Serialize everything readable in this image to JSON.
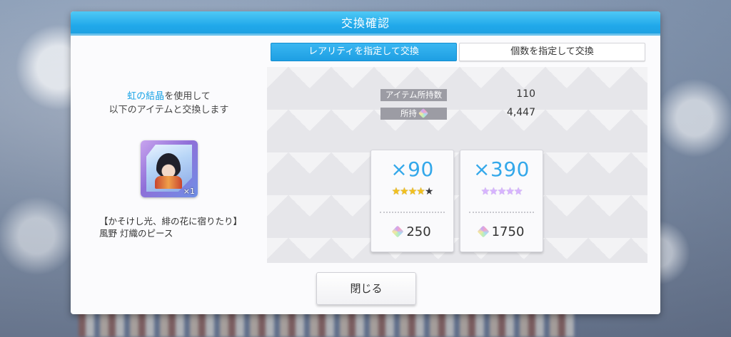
{
  "dialog": {
    "title": "交換確認"
  },
  "tabs": [
    {
      "label": "レアリティを指定して交換",
      "active": true
    },
    {
      "label": "個数を指定して交換",
      "active": false
    }
  ],
  "description": {
    "highlight": "虹の結晶",
    "line1_rest": "を使用して",
    "line2": "以下のアイテムと交換します"
  },
  "item": {
    "quantity_badge": "×1",
    "name_line1": "【かそけし光、緋の花に宿りたり】",
    "name_line2": "風野 灯織のピース",
    "icon": "piece-icon"
  },
  "stats": {
    "owned_items_label": "アイテム所持数",
    "owned_items_value": "110",
    "owned_currency_label": "所持",
    "owned_currency_value": "4,447",
    "currency_icon": "rainbow-crystal-icon"
  },
  "options": [
    {
      "multiplier": "×90",
      "stars_filled": 4,
      "stars_total": 5,
      "star_color": "gold",
      "cost": "250"
    },
    {
      "multiplier": "×390",
      "stars_filled": 5,
      "stars_total": 5,
      "star_color": "purple",
      "cost": "1750"
    }
  ],
  "buttons": {
    "close": "閉じる"
  },
  "colors": {
    "accent": "#1ea0e0",
    "highlight_text": "#19a3e6"
  }
}
